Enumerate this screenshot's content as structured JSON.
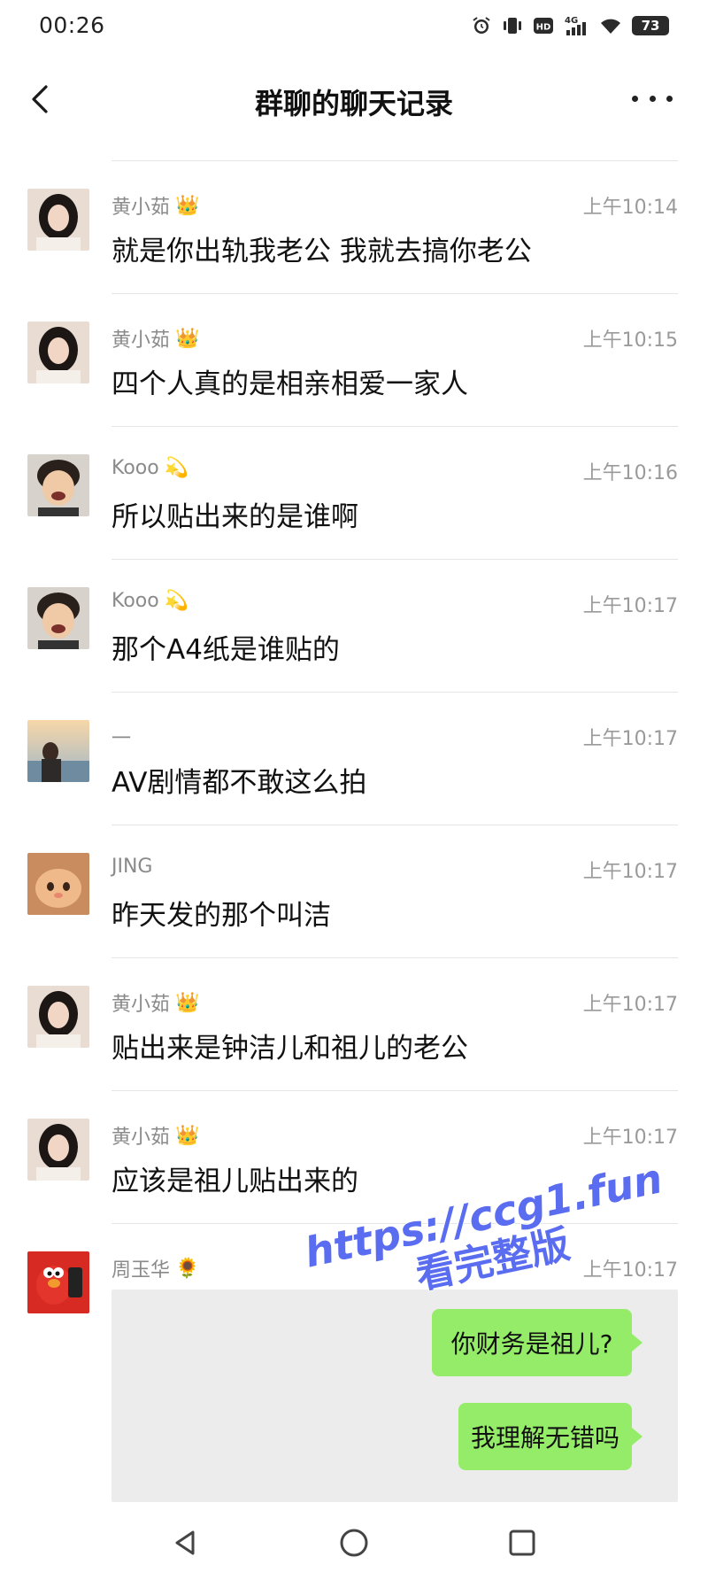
{
  "status_bar": {
    "time": "00:26",
    "battery": "73",
    "icons": [
      "alarm-icon",
      "vibrate-icon",
      "hd-icon",
      "signal-4g-icon",
      "wifi-icon",
      "battery-icon"
    ],
    "signal_label": "4G",
    "hd_label": "HD"
  },
  "header": {
    "title": "群聊的聊天记录",
    "back_icon": "chevron-left-icon",
    "more_icon": "more-dots-icon"
  },
  "messages": [
    {
      "sender": "黄小茹",
      "badge": "👑",
      "time": "上午10:14",
      "text": "就是你出轨我老公 我就去搞你老公",
      "avatar": "avatar-woman-1"
    },
    {
      "sender": "黄小茹",
      "badge": "👑",
      "time": "上午10:15",
      "text": "四个人真的是相亲相爱一家人",
      "avatar": "avatar-woman-1"
    },
    {
      "sender": "Kooo",
      "badge": "💫",
      "time": "上午10:16",
      "text": "所以贴出来的是谁啊",
      "avatar": "avatar-child"
    },
    {
      "sender": "Kooo",
      "badge": "💫",
      "time": "上午10:17",
      "text": "那个A4纸是谁贴的",
      "avatar": "avatar-child"
    },
    {
      "sender": "一",
      "badge": "",
      "time": "上午10:17",
      "text": "AV剧情都不敢这么拍",
      "avatar": "avatar-sunset"
    },
    {
      "sender": "JING",
      "badge": "",
      "time": "上午10:17",
      "text": "昨天发的那个叫洁",
      "avatar": "avatar-cat"
    },
    {
      "sender": "黄小茹",
      "badge": "👑",
      "time": "上午10:17",
      "text": "贴出来是钟洁儿和祖儿的老公",
      "avatar": "avatar-woman-1"
    },
    {
      "sender": "黄小茹",
      "badge": "👑",
      "time": "上午10:17",
      "text": "应该是祖儿贴出来的",
      "avatar": "avatar-woman-1"
    },
    {
      "sender": "周玉华",
      "badge": "🌻",
      "time": "上午10:17",
      "text": "",
      "avatar": "avatar-elmo"
    }
  ],
  "image_message": {
    "bubbles": [
      "你财务是祖儿?",
      "我理解无错吗"
    ]
  },
  "watermark": {
    "line1": "https://ccg1.fun",
    "line2": "看完整版",
    "color": "#5a6cf0"
  },
  "nav_buttons": [
    "back-triangle-icon",
    "home-circle-icon",
    "recents-square-icon"
  ],
  "colors": {
    "bubble": "#95ec69",
    "accent_watermark": "#5a6cf0"
  }
}
